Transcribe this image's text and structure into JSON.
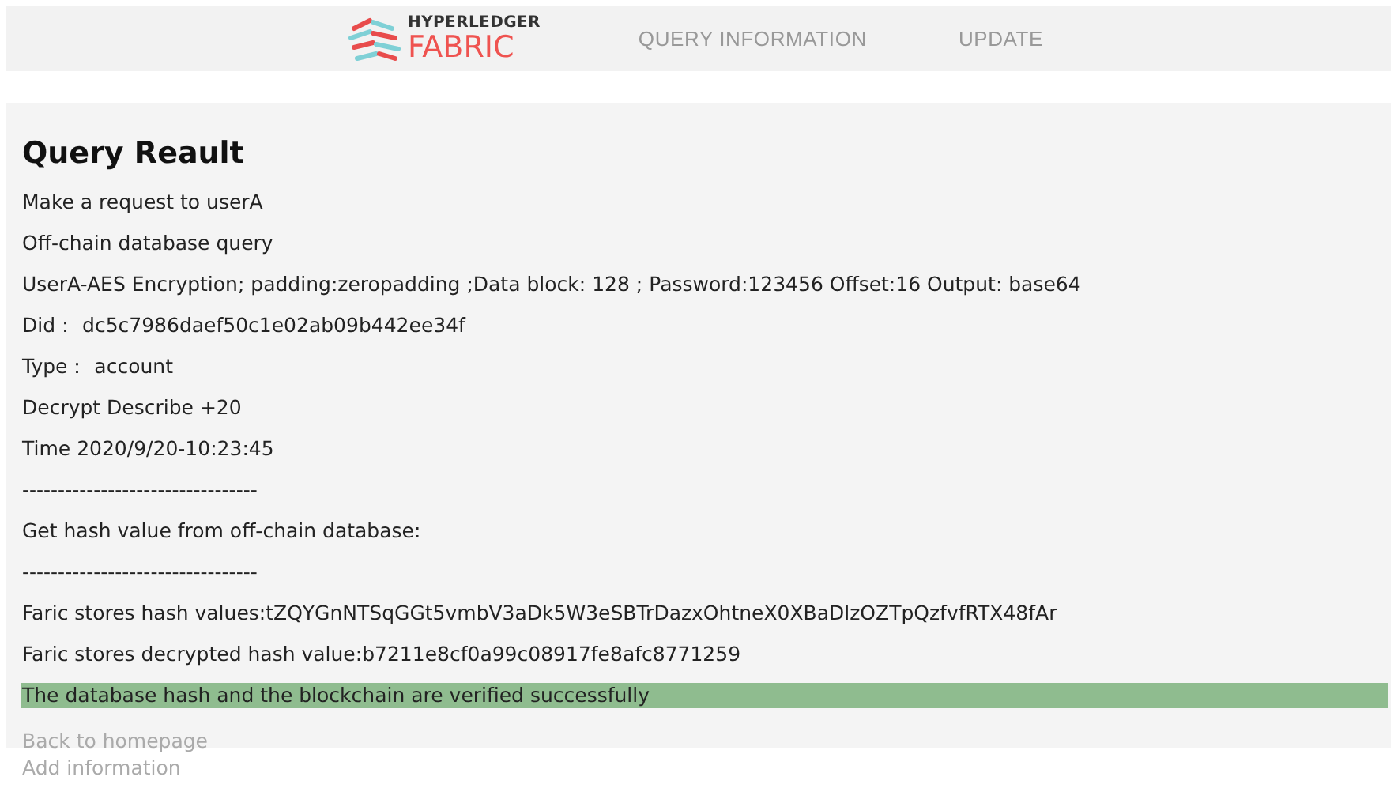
{
  "header": {
    "logo_top": "HYPERLEDGER",
    "logo_bottom": "FABRIC",
    "nav": [
      {
        "label": "QUERY INFORMATION",
        "selected": false
      },
      {
        "label": "UPDATE",
        "selected": false
      }
    ]
  },
  "result": {
    "title": "Query Reault",
    "lines": [
      {
        "kind": "text",
        "text": "Make a request to userA"
      },
      {
        "kind": "text",
        "text": "Off-chain database query"
      },
      {
        "kind": "text",
        "text": "UserA-AES Encryption; padding:zeropadding ;Data block: 128 ; Password:123456 Offset:16 Output: base64"
      },
      {
        "kind": "text",
        "text": "Did：  dc5c7986daef50c1e02ab09b442ee34f"
      },
      {
        "kind": "text",
        "text": "Type：  account"
      },
      {
        "kind": "text",
        "text": "Decrypt Describe +20"
      },
      {
        "kind": "text",
        "text": "Time 2020/9/20-10:23:45"
      },
      {
        "kind": "divider",
        "text": "---------------------------------"
      },
      {
        "kind": "text",
        "text": "Get hash value from off-chain database:"
      },
      {
        "kind": "divider",
        "text": "---------------------------------"
      },
      {
        "kind": "text",
        "text": "Faric stores hash values:tZQYGnNTSqGGt5vmbV3aDk5W3eSBTrDazxOhtneX0XBaDlzOZTpQzfvfRTX48fAr"
      },
      {
        "kind": "text",
        "text": "Faric stores decrypted hash value:b7211e8cf0a99c08917fe8afc8771259"
      },
      {
        "kind": "success",
        "text": "The database hash and the blockchain are verified successfully"
      }
    ],
    "links": [
      "Back to homepage",
      "Add information"
    ]
  }
}
